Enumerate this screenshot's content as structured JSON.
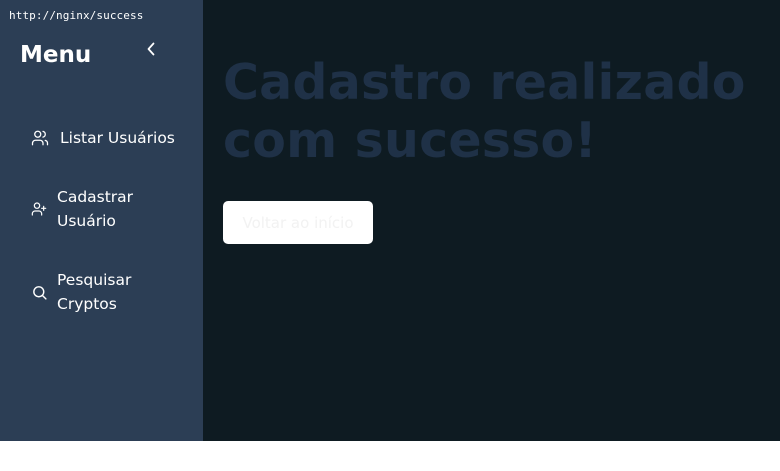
{
  "browser": {
    "url": "http://nginx/success"
  },
  "sidebar": {
    "title": "Menu",
    "collapse_icon": "chevron-left-icon",
    "items": [
      {
        "label": "Listar Usuários",
        "icon": "users-icon"
      },
      {
        "label": "Cadastrar\nUsuário",
        "icon": "user-plus-icon"
      },
      {
        "label": "Pesquisar\nCryptos",
        "icon": "search-icon"
      }
    ]
  },
  "main": {
    "heading": "Cadastro realizado com sucesso!",
    "back_button_label": "Voltar ao início"
  },
  "colors": {
    "sidebar_bg": "#2c3e55",
    "main_bg": "#0e1b22",
    "heading": "#1f3147",
    "button_bg": "#ffffff"
  }
}
